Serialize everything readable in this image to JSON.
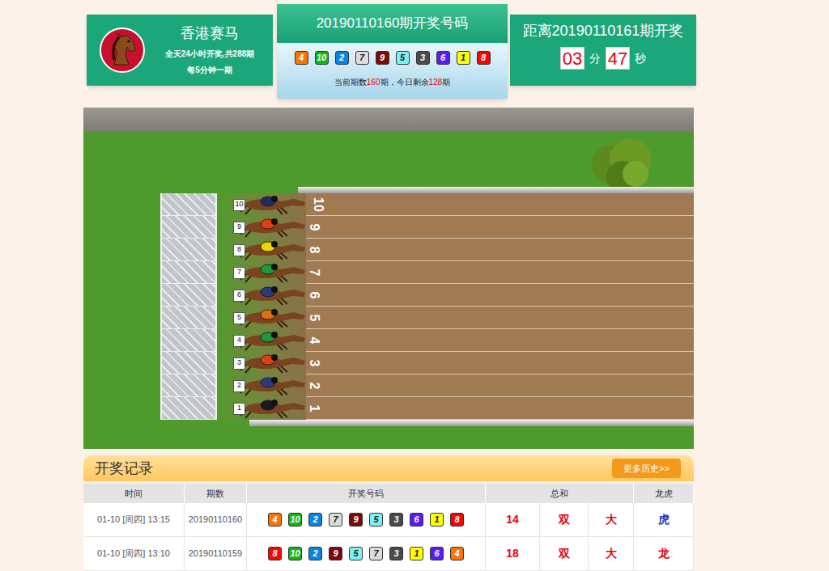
{
  "header": {
    "logo_title": "香港赛马",
    "desc1": "全天24小时开奖,共288期",
    "desc2": "每5分钟一期"
  },
  "current": {
    "title": "20190110160期开奖号码",
    "balls": [
      {
        "n": "4",
        "color": "#ff7300"
      },
      {
        "n": "10",
        "color": "#13b613"
      },
      {
        "n": "2",
        "color": "#0b83e6"
      },
      {
        "n": "7",
        "color": "#dcdcdc"
      },
      {
        "n": "9",
        "color": "#7a0a0a"
      },
      {
        "n": "5",
        "color": "#7ff0f0"
      },
      {
        "n": "3",
        "color": "#4a4a4a"
      },
      {
        "n": "6",
        "color": "#5b1cf0"
      },
      {
        "n": "1",
        "color": "#ffff00"
      },
      {
        "n": "8",
        "color": "#ff0000"
      }
    ],
    "status": [
      {
        "text": "当前期数",
        "highlight": false
      },
      {
        "text": "160",
        "highlight": true
      },
      {
        "text": "期，今日剩余",
        "highlight": false
      },
      {
        "text": "128",
        "highlight": true
      },
      {
        "text": "期",
        "highlight": false
      }
    ]
  },
  "countdown": {
    "title": "距离20190110161期开奖",
    "minutes": "03",
    "min_unit": "分",
    "seconds": "47",
    "sec_unit": "秒"
  },
  "race": {
    "lanes": [
      {
        "number": "10",
        "jockey_color": "#222a60"
      },
      {
        "number": "9",
        "jockey_color": "#e04010"
      },
      {
        "number": "8",
        "jockey_color": "#e8d800"
      },
      {
        "number": "7",
        "jockey_color": "#1a9a3a"
      },
      {
        "number": "6",
        "jockey_color": "#2a3a7a"
      },
      {
        "number": "5",
        "jockey_color": "#e07010"
      },
      {
        "number": "4",
        "jockey_color": "#1a9a3a"
      },
      {
        "number": "3",
        "jockey_color": "#e04010"
      },
      {
        "number": "2",
        "jockey_color": "#2a3a7a"
      },
      {
        "number": "1",
        "jockey_color": "#1a1a1a"
      }
    ]
  },
  "records": {
    "title": "开奖记录",
    "more_button": "更多历史>>",
    "columns": [
      "时间",
      "期数",
      "开奖号码",
      "总和",
      "龙虎"
    ],
    "rows": [
      {
        "time": "01-10 [周四] 13:15",
        "issue": "20190110160",
        "balls": [
          {
            "n": "4",
            "color": "#ff7300"
          },
          {
            "n": "10",
            "color": "#13b613"
          },
          {
            "n": "2",
            "color": "#0b83e6"
          },
          {
            "n": "7",
            "color": "#dcdcdc"
          },
          {
            "n": "9",
            "color": "#7a0a0a"
          },
          {
            "n": "5",
            "color": "#7ff0f0"
          },
          {
            "n": "3",
            "color": "#4a4a4a"
          },
          {
            "n": "6",
            "color": "#5b1cf0"
          },
          {
            "n": "1",
            "color": "#ffff00"
          },
          {
            "n": "8",
            "color": "#ff0000"
          }
        ],
        "results": [
          {
            "text": "14",
            "color": "#e60012"
          },
          {
            "text": "双",
            "color": "#e60012"
          },
          {
            "text": "大",
            "color": "#e60012"
          },
          {
            "text": "虎",
            "color": "#1d39c4"
          }
        ]
      },
      {
        "time": "01-10 [周四] 13:10",
        "issue": "20190110159",
        "balls": [
          {
            "n": "8",
            "color": "#ff0000"
          },
          {
            "n": "10",
            "color": "#13b613"
          },
          {
            "n": "2",
            "color": "#0b83e6"
          },
          {
            "n": "9",
            "color": "#7a0a0a"
          },
          {
            "n": "5",
            "color": "#7ff0f0"
          },
          {
            "n": "7",
            "color": "#dcdcdc"
          },
          {
            "n": "3",
            "color": "#4a4a4a"
          },
          {
            "n": "1",
            "color": "#ffff00"
          },
          {
            "n": "6",
            "color": "#5b1cf0"
          },
          {
            "n": "4",
            "color": "#ff7300"
          }
        ],
        "results": [
          {
            "text": "18",
            "color": "#e60012"
          },
          {
            "text": "双",
            "color": "#e60012"
          },
          {
            "text": "大",
            "color": "#e60012"
          },
          {
            "text": "龙",
            "color": "#e60012"
          }
        ]
      }
    ]
  }
}
